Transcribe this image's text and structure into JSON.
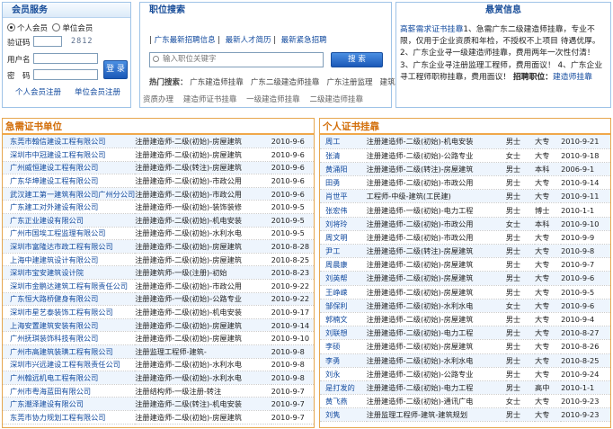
{
  "member": {
    "title": "会员服务",
    "radio_personal": "个人会员",
    "radio_company": "单位会员",
    "label_code": "验证码",
    "code_value": "2812",
    "label_user": "用户名",
    "label_pwd": "密　码",
    "login_btn": "登 录",
    "register_personal": "个人会员注册",
    "register_company": "单位会员注册"
  },
  "jobs": {
    "title": "职位搜索",
    "tabs": [
      "广东最新招聘信息",
      "最新人才简历",
      "最新紧急招聘"
    ],
    "search_placeholder": "输入职位关键字",
    "search_btn": "搜 索",
    "hot_label": "热门搜索：",
    "hot_terms": [
      "广东建造师挂靠",
      "广东二级建造师挂靠",
      "广东注册监理",
      "建筑"
    ],
    "hot_terms2": [
      "资质办理",
      "建造师证书挂靠",
      "一级建造师挂靠",
      "二级建造师挂靠"
    ]
  },
  "notice": {
    "title": "悬赏信息",
    "lines": [
      "高薪需求证书挂靠",
      "1、急需广东二级建造师挂靠，专业不限，仅用于企业资质和年检，不授权不上项目 待遇优厚。",
      "2、广东企业寻一级建造师挂靠，费用两年一次性付清！",
      "3、广东企业寻注册监理工程师，费用面议！",
      "4、广东企业寻工程师职称挂靠，费用面议！",
      "招聘职位：",
      "建造师挂靠"
    ]
  },
  "left_section": {
    "title": "急需证书单位",
    "rows": [
      [
        "东莞市翰信建设工程有限公司",
        "注册建造师-二级(初始)-房屋建筑",
        "2010-9-6"
      ],
      [
        "深圳市中冠建设工程有限公司",
        "注册建造师-二级(初始)-房屋建筑",
        "2010-9-6"
      ],
      [
        "广州威恒建设工程有限公司",
        "注册建造师-二级(转注)-房屋建筑",
        "2010-9-6"
      ],
      [
        "广东华坤建设工程有限公司",
        "注册建造师-二级(初始)-市政公用",
        "2010-9-6"
      ],
      [
        "武汉建工第一建筑有限公司广州分公司",
        "注册建造师-二级(初始)-市政公用",
        "2010-9-6"
      ],
      [
        "广东建工对外建设有限公司",
        "注册建造师-一级(初始)-装饰装修",
        "2010-9-5"
      ],
      [
        "广东正业建设有限公司",
        "注册建造师-二级(初始)-机电安装",
        "2010-9-5"
      ],
      [
        "广州市国埃工程监理有限公司",
        "注册建造师-二级(初始)-水利水电",
        "2010-9-5"
      ],
      [
        "深圳市富隆达市政工程有限公司",
        "注册建造师-二级(初始)-房屋建筑",
        "2010-8-28"
      ],
      [
        "上海中建建筑设计有限公司",
        "注册建造师-二级(初始)-房屋建筑",
        "2010-8-25"
      ],
      [
        "深圳市宝安建筑设计院",
        "注册建筑师-一级(注册)-初始",
        "2010-8-23"
      ],
      [
        "深圳市金鹏达建筑工程有限责任公司",
        "注册建造师-二级(初始)-市政公用",
        "2010-9-22"
      ],
      [
        "广东恒大路桥健身有限公司",
        "注册建造师-一级(初始)-公路专业",
        "2010-9-22"
      ],
      [
        "深圳市星艺泰装饰工程有限公司",
        "注册建造师-二级(初始)-机电安装",
        "2010-9-17"
      ],
      [
        "上海安置建筑安装有限公司",
        "注册建造师-二级(初始)-房屋建筑",
        "2010-9-14"
      ],
      [
        "广州抚琪装饰科技有限公司",
        "注册建造师-二级(初始)-房屋建筑",
        "2010-9-10"
      ],
      [
        "广州市高建筑装璜工程有限公司",
        "注册监理工程师-建筑-",
        "2010-9-8"
      ],
      [
        "深圳市兴远建设工程有限责任公司",
        "注册建造师-二级(初始)-水利水电",
        "2010-9-8"
      ],
      [
        "广州翰远机电工程有限公司",
        "注册建造师-一级(初始)-水利水电",
        "2010-9-8"
      ],
      [
        "广州市粤海蓝田有限公司",
        "注册结构师-一级注册-转注",
        "2010-9-7"
      ],
      [
        "广东潮泽建设有限公司",
        "注册建造师-二级(转注)-机电安装",
        "2010-9-7"
      ],
      [
        "东莞市协力规划工程有限公司",
        "注册建造师-二级(初始)-房屋建筑",
        "2010-9-7"
      ]
    ]
  },
  "right_section": {
    "title": "个人证书挂靠",
    "rows": [
      [
        "周工",
        "注册建造师-二级(初始)-机电安装",
        "男士",
        "大专",
        "2010-9-21"
      ],
      [
        "张清",
        "注册建造师-二级(初始)-公路专业",
        "女士",
        "大专",
        "2010-9-18"
      ],
      [
        "黄涌阳",
        "注册建造师-二级(转注)-房屋建筑",
        "男士",
        "本科",
        "2006-9-1"
      ],
      [
        "田勇",
        "注册建造师-二级(初始)-市政公用",
        "男士",
        "大专",
        "2010-9-14"
      ],
      [
        "肖世平",
        "工程师-中级-建筑(工民建)",
        "男士",
        "大专",
        "2010-9-11"
      ],
      [
        "张宏伟",
        "注册建造师-一级(初始)-电力工程",
        "男士",
        "博士",
        "2010-1-1"
      ],
      [
        "刘将玲",
        "注册建造师-二级(初始)-市政公用",
        "女士",
        "本科",
        "2010-9-10"
      ],
      [
        "周文明",
        "注册建造师-二级(初始)-市政公用",
        "男士",
        "大专",
        "2010-9-9"
      ],
      [
        "尹工",
        "注册建造师-二级(转注)-房屋建筑",
        "男士",
        "大专",
        "2010-9-8"
      ],
      [
        "周晨康",
        "注册建造师-二级(初始)-房屋建筑",
        "男士",
        "大专",
        "2010-9-7"
      ],
      [
        "刘英帮",
        "注册建造师-二级(初始)-房屋建筑",
        "男士",
        "大专",
        "2010-9-6"
      ],
      [
        "王峥嵘",
        "注册建造师-二级(初始)-房屋建筑",
        "男士",
        "大专",
        "2010-9-5"
      ],
      [
        "邹保利",
        "注册建造师-二级(初始)-水利水电",
        "女士",
        "大专",
        "2010-9-6"
      ],
      [
        "郭楠文",
        "注册建造师-二级(初始)-房屋建筑",
        "男士",
        "大专",
        "2010-9-4"
      ],
      [
        "刘联想",
        "注册建造师-二级(初始)-电力工程",
        "男士",
        "大专",
        "2010-8-27"
      ],
      [
        "李硕",
        "注册建造师-二级(初始)-房屋建筑",
        "男士",
        "大专",
        "2010-8-26"
      ],
      [
        "李勇",
        "注册建造师-二级(初始)-水利水电",
        "男士",
        "大专",
        "2010-8-25"
      ],
      [
        "刘永",
        "注册建造师-二级(初始)-公路专业",
        "男士",
        "大专",
        "2010-9-24"
      ],
      [
        "是打发的",
        "注册建造师-二级(初始)-电力工程",
        "男士",
        "高中",
        "2010-1-1"
      ],
      [
        "黄飞燕",
        "注册建造师-二级(初始)-通讯广电",
        "女士",
        "大专",
        "2010-9-23"
      ],
      [
        "刘隽",
        "注册监理工程师-建筑-建筑规划",
        "男士",
        "大专",
        "2010-9-23"
      ]
    ]
  }
}
